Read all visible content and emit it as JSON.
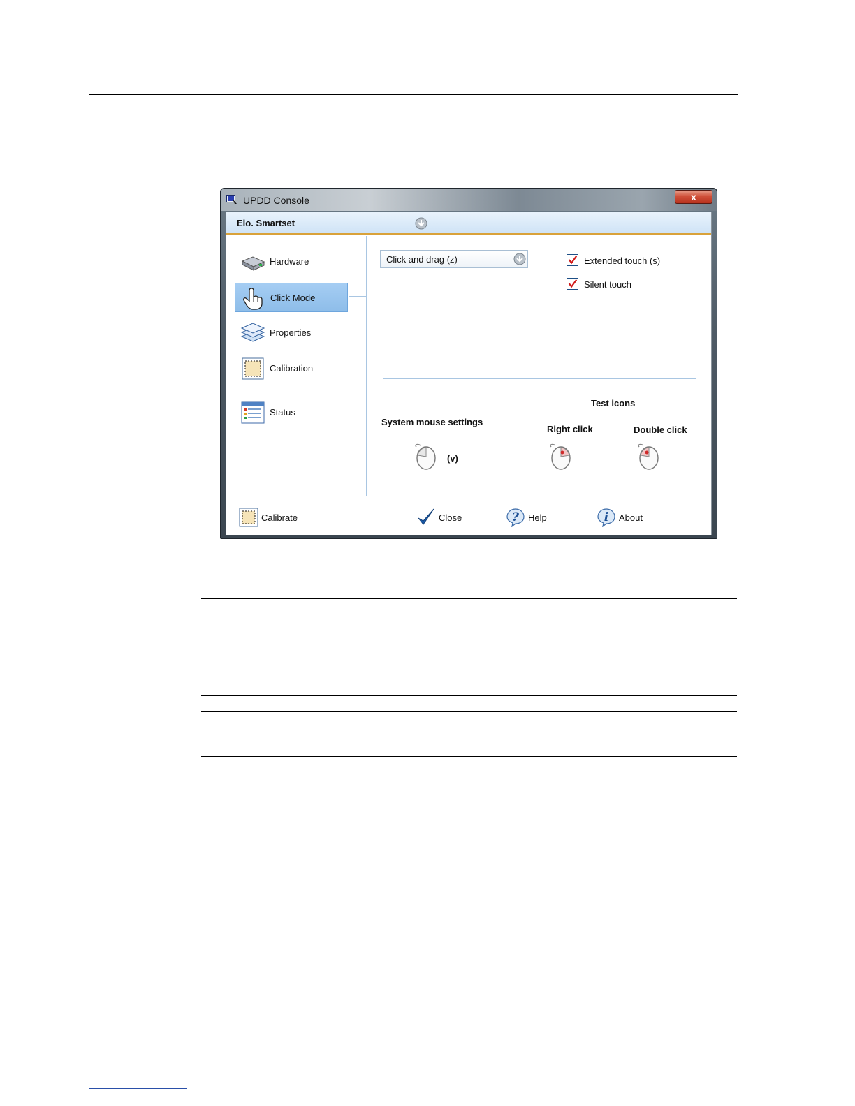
{
  "window": {
    "title": "UPDD Console",
    "close_glyph": "x"
  },
  "device": {
    "name": "Elo. Smartset",
    "dropdown_icon": "down-arrow-circle-icon"
  },
  "sidebar": {
    "items": [
      {
        "label": "Hardware",
        "icon": "hardware-drive-icon",
        "active": false
      },
      {
        "label": "Click Mode",
        "icon": "hand-pointer-icon",
        "active": true
      },
      {
        "label": "Properties",
        "icon": "layers-icon",
        "active": false
      },
      {
        "label": "Calibration",
        "icon": "calibration-grid-icon",
        "active": false
      },
      {
        "label": "Status",
        "icon": "status-list-icon",
        "active": false
      }
    ]
  },
  "panel": {
    "click_mode_value": "Click and drag (z)",
    "extended_touch": {
      "label": "Extended touch (s)",
      "checked": true
    },
    "silent_touch": {
      "label": "Silent touch",
      "checked": true
    },
    "test_icons_label": "Test icons",
    "system_mouse_label": "System mouse settings",
    "system_mouse_shortcut": "(v)",
    "right_click_label": "Right click",
    "double_click_label": "Double click"
  },
  "bottom": {
    "calibrate": "Calibrate",
    "close": "Close",
    "help": "Help",
    "about": "About"
  },
  "colors": {
    "active_nav": "#8ebde9",
    "accent_border": "#d9a23a",
    "checkmark": "#d01818",
    "close_check": "#1b5cab"
  }
}
